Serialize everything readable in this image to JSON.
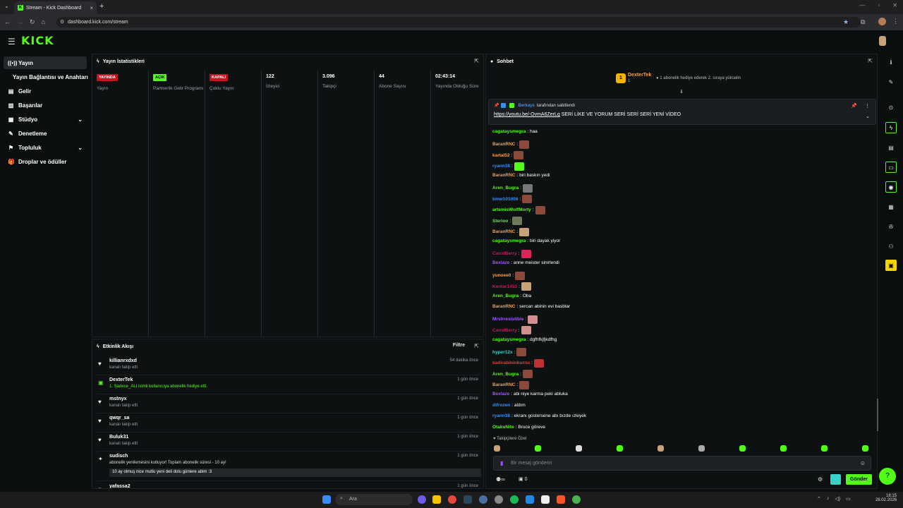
{
  "browser": {
    "tab_title": "Stream - Kick Dashboard",
    "url": "dashboard.kick.com/stream"
  },
  "header": {
    "logo": "KICK"
  },
  "sidebar": {
    "items": [
      {
        "label": "Yayın",
        "icon": "stream-icon",
        "active": true
      },
      {
        "label": "Yayın Bağlantısı ve Anahtarı",
        "sub": true
      },
      {
        "label": "Gelir",
        "icon": "revenue-icon"
      },
      {
        "label": "Başarılar",
        "icon": "achievements-icon"
      },
      {
        "label": "Stüdyo",
        "icon": "studio-icon",
        "expand": true
      },
      {
        "label": "Denetleme",
        "icon": "moderation-icon"
      },
      {
        "label": "Topluluk",
        "icon": "community-icon",
        "expand": true
      },
      {
        "label": "Droplar ve ödüller",
        "icon": "drops-icon"
      }
    ]
  },
  "stats": {
    "title": "Yayın İstatistikleri",
    "columns": [
      {
        "value": "YAYINDA",
        "badge": "red",
        "label": "Yayın"
      },
      {
        "value": "AÇIK",
        "badge": "green",
        "label": "Partnerlik Gelir Programı"
      },
      {
        "value": "KAPALI",
        "badge": "red",
        "label": "Çoklu Yayın"
      },
      {
        "value": "122",
        "label": "İzleyici"
      },
      {
        "value": "3.096",
        "label": "Takipçi"
      },
      {
        "value": "44",
        "label": "Abone Sayısı"
      },
      {
        "value": "02:43:14",
        "label": "Yayında Olduğu Süre"
      }
    ]
  },
  "feed": {
    "title": "Etkinlik Akışı",
    "filter_label": "Filtre",
    "rows": [
      {
        "name": "killianrxdxd",
        "desc": "kanalı takip etti",
        "time": "54 dakika önce",
        "icon": "heart-icon"
      },
      {
        "name": "DexterTek",
        "desc": "1. Sadece_ALI isimli kullanıcıya abonelik hediye etti.",
        "time": "1 gün önce",
        "icon": "gift-icon",
        "green": true
      },
      {
        "name": "mstnyx",
        "desc": "kanalı takip etti",
        "time": "1 gün önce",
        "icon": "heart-icon"
      },
      {
        "name": "qwqr_sa",
        "desc": "kanalı takip etti",
        "time": "1 gün önce",
        "icon": "heart-icon"
      },
      {
        "name": "Buluk31",
        "desc": "kanalı takip etti",
        "time": "1 gün önce",
        "icon": "heart-icon"
      },
      {
        "name": "sudisch",
        "desc": "abonelik yenilemesini kutluyor! Toplam abonelik süresi - 10 ay!",
        "time": "1 gün önce",
        "icon": "star-icon",
        "message": "10 ay olmuş nice mutlu yeni deli dolu günlere abim :3"
      },
      {
        "name": "yafassa2",
        "desc": "",
        "time": "1 gün önce",
        "icon": "heart-icon"
      }
    ]
  },
  "chat": {
    "title": "Sohbet",
    "top_gifter": {
      "name": "DexterTek",
      "count": "1",
      "rank": "1",
      "hint": "1 abonelik hediye ederek 2. sıraya yükselin"
    },
    "pinned": {
      "by": "Berkays",
      "by_suffix": "tarafından sabitlendi",
      "link": "https://youtu.be/-OvmA6ZerLg",
      "text": " SERİ LİKE VE YORUM SERİ SERİ SERİ YENİ VİDEO"
    },
    "messages": [
      {
        "user": "cagataysmegra",
        "color": "#53fc18",
        "text": ": haa"
      },
      {
        "user": "BaranRNC",
        "color": "#f0a050",
        "text": ":",
        "emote": "#8a4a3a"
      },
      {
        "user": "kartal52",
        "color": "#f0a050",
        "text": ":",
        "emote": "#8a4a3a"
      },
      {
        "user": "ryann38",
        "color": "#3b8cf0",
        "text": ":",
        "emote": "#53fc18"
      },
      {
        "user": "BaranRNC",
        "color": "#f0a050",
        "text": ": biri baskın yedi"
      },
      {
        "user": "Aren_Bugra",
        "color": "#53fc18",
        "text": ":",
        "emote": "#777777"
      },
      {
        "user": "bmw101006",
        "color": "#3b8cf0",
        "text": ":",
        "emote": "#8a4a3a"
      },
      {
        "user": "artemisWolfMorty",
        "color": "#53fc18",
        "text": ":",
        "emote": "#8a4a3a"
      },
      {
        "user": "Sterioo",
        "color": "#53fc18",
        "text": ":",
        "emote": "#6a7a5a"
      },
      {
        "user": "BaranRNC",
        "color": "#f0a050",
        "text": ":",
        "emote": "#c8a27a"
      },
      {
        "user": "cagataysmegra",
        "color": "#53fc18",
        "text": ": biri dayak yiyor"
      },
      {
        "user": "CanslBerry",
        "color": "#d0145a",
        "text": ":",
        "emote": "#e0245a"
      },
      {
        "user": "Bexlaze",
        "color": "#9b59ff",
        "text": ": anne meister sinirlendi"
      },
      {
        "user": "yunoee0",
        "color": "#f0a050",
        "text": ":",
        "emote": "#8a4a3a"
      },
      {
        "user": "Kentar1453",
        "color": "#d0145a",
        "text": ":",
        "emote": "#c8a27a"
      },
      {
        "user": "Aren_Bugra",
        "color": "#53fc18",
        "text": ": Oba"
      },
      {
        "user": "BaranRNC",
        "color": "#f0a050",
        "text": ": sercan abinin evi basblar"
      },
      {
        "user": "MrsIrresistible",
        "color": "#9b59ff",
        "text": ":",
        "emote": "#d09090"
      },
      {
        "user": "CanslBerry",
        "color": "#d0145a",
        "text": ":",
        "emote": "#d09090"
      },
      {
        "user": "cagataysmegra",
        "color": "#53fc18",
        "text": ": dgfhfkjfjkdfhg"
      },
      {
        "user": "hyper12x",
        "color": "#3bd0c8",
        "text": ":",
        "emote": "#8a4a3a"
      },
      {
        "user": "kadirabininburnu",
        "color": "#e04040",
        "text": ":",
        "emote": "#c03030"
      },
      {
        "user": "Aren_Bugra",
        "color": "#53fc18",
        "text": ":",
        "emote": "#8a4a3a"
      },
      {
        "user": "BaranRNC",
        "color": "#f0a050",
        "text": ":",
        "emote": "#8a4a3a"
      },
      {
        "user": "Bexlaze",
        "color": "#9b59ff",
        "text": ": abi niye karma peki abluka"
      },
      {
        "user": "difrozen",
        "color": "#3b8cf0",
        "text": ": aldım"
      },
      {
        "user": "ryann38",
        "color": "#3b8cf0",
        "text": ": ekranı gostersene abı bızde ızleyek"
      },
      {
        "user": "OtakuNite",
        "color": "#53fc18",
        "text": ": Bruce göreve"
      }
    ],
    "followers_only": "Takipçilere Özel",
    "input_placeholder": "Bir mesaj gönderin",
    "count_infinity": "∞",
    "count_zero": "0",
    "send_label": "Gönder"
  },
  "taskbar": {
    "search_placeholder": "Ara",
    "time": "18:15",
    "date": "28.02.2026"
  }
}
